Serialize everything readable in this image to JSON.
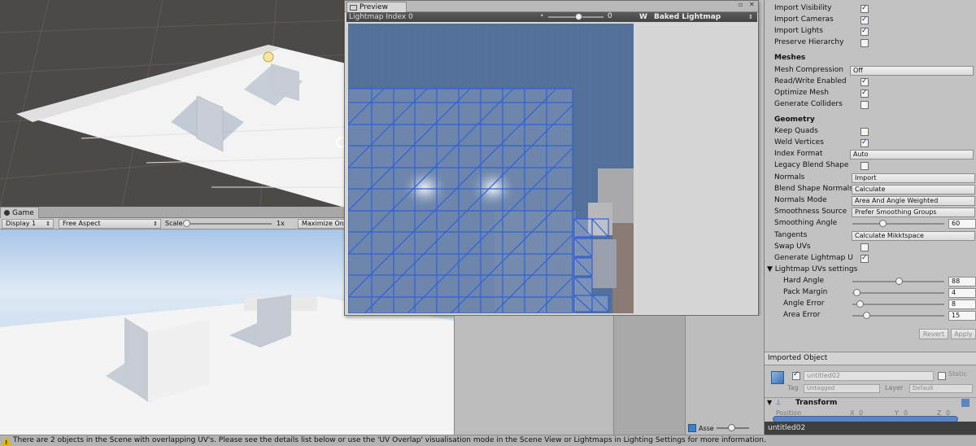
{
  "preview": {
    "tab_label": "Preview",
    "lightmap_index_label": "Lightmap Index 0",
    "index_value": "0",
    "mode_w": "W",
    "mode_label": "Baked Lightmap"
  },
  "game": {
    "tab_label": "Game",
    "display": "Display 1",
    "aspect": "Free Aspect",
    "scale_label": "Scale",
    "scale_value": "1x",
    "maximize_label": "Maximize On Pl"
  },
  "inspector": {
    "import_visibility": "Import Visibility",
    "import_cameras": "Import Cameras",
    "import_lights": "Import Lights",
    "preserve_hierarchy": "Preserve Hierarchy",
    "meshes_header": "Meshes",
    "mesh_compression": "Mesh Compression",
    "mesh_compression_value": "Off",
    "read_write": "Read/Write Enabled",
    "optimize_mesh": "Optimize Mesh",
    "generate_colliders": "Generate Colliders",
    "geometry_header": "Geometry",
    "keep_quads": "Keep Quads",
    "weld_vertices": "Weld Vertices",
    "index_format": "Index Format",
    "index_format_value": "Auto",
    "legacy_blend": "Legacy Blend Shape",
    "normals": "Normals",
    "normals_value": "Import",
    "blend_shape_normals": "Blend Shape Normals",
    "blend_shape_normals_value": "Calculate",
    "normals_mode": "Normals Mode",
    "normals_mode_value": "Area And Angle Weighted",
    "smoothness_source": "Smoothness Source",
    "smoothness_source_value": "Prefer Smoothing Groups",
    "smoothing_angle": "Smoothing Angle",
    "smoothing_angle_value": "60",
    "tangents": "Tangents",
    "tangents_value": "Calculate Mikktspace",
    "swap_uvs": "Swap UVs",
    "generate_lightmap": "Generate Lightmap U",
    "lightmap_uvs_settings": "Lightmap UVs settings",
    "hard_angle": "Hard Angle",
    "hard_angle_value": "88",
    "pack_margin": "Pack Margin",
    "pack_margin_value": "4",
    "angle_error": "Angle Error",
    "angle_error_value": "8",
    "area_error": "Area Error",
    "area_error_value": "15",
    "revert": "Revert",
    "apply": "Apply",
    "imported_object": "Imported Object",
    "object_name": "untitled02",
    "static_label": "Static",
    "tag_label": "Tag",
    "tag_value": "Untagged",
    "layer_label": "Layer",
    "layer_value": "Default",
    "transform": "Transform",
    "position": "Position",
    "pos_x": "X",
    "pos_x_value": "0",
    "pos_y": "Y",
    "pos_y_value": "0",
    "pos_z": "Z",
    "pos_z_value": "0",
    "asset_label": "untitled02"
  },
  "slider_levels": {
    "smoothing_angle": 0.33,
    "hard_angle": 0.5,
    "pack_margin": 0.04,
    "angle_error": 0.08,
    "area_error": 0.15
  },
  "assets_label": "Asse",
  "status_text": "There are 2 objects in the Scene with overlapping UV's. Please see the details list below or use the 'UV Overlap' visualisation mode in the Scene View or Lightmaps in Lighting Settings for more information.",
  "colors": {
    "lightmap_bg": "#53709a",
    "uv_lines": "#2f62d9",
    "warning": "#e8b400"
  }
}
